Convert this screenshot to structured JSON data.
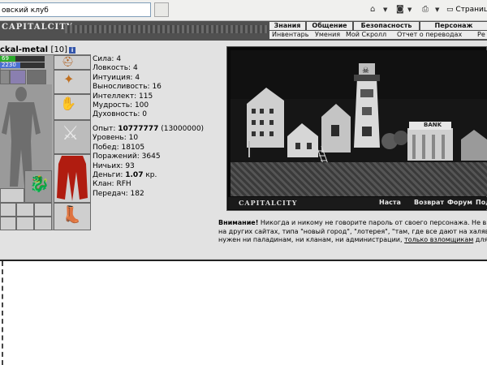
{
  "browser": {
    "tab_title": "овский клуб",
    "page_menu": "Страница"
  },
  "header": {
    "logo": "CAPITALCITY",
    "top_nav": [
      "Знания",
      "Общение",
      "Безопасность",
      "Персонаж"
    ],
    "sub_nav": [
      "Инвентарь",
      "Умения",
      "Мой Скролл",
      "Отчет о переводах",
      "Ре"
    ]
  },
  "character": {
    "name": "ckal-metal",
    "level": "[10]",
    "hp_text": "69",
    "hp_fraction": 0.35,
    "mp_text": "2230",
    "mp_fraction": 0.45,
    "attributes": [
      {
        "label": "Сила:",
        "value": "4"
      },
      {
        "label": "Ловкость:",
        "value": "4"
      },
      {
        "label": "Интуиция:",
        "value": "4"
      },
      {
        "label": "Выносливость:",
        "value": "16"
      },
      {
        "label": "Интеллект:",
        "value": "115"
      },
      {
        "label": "Мудрость:",
        "value": "100"
      },
      {
        "label": "Духовность:",
        "value": "0"
      }
    ],
    "experience_label": "Опыт:",
    "experience": "10777777",
    "experience_next": "(13000000)",
    "level_label": "Уровень:",
    "level_value": "10",
    "wins_label": "Побед:",
    "wins": "18105",
    "losses_label": "Поражений:",
    "losses": "3645",
    "draws_label": "Ничьих:",
    "draws": "93",
    "money_label": "Деньги:",
    "money": "1.07",
    "money_unit": "кр.",
    "clan_label": "Клан:",
    "clan": "RFH",
    "transfers_label": "Передач:",
    "transfers": "182"
  },
  "city": {
    "logo": "CAPITALCITY",
    "bank_sign": "BANK",
    "links": [
      "Наста",
      "Возврат",
      "Форум",
      "Под"
    ]
  },
  "warning": {
    "bold": "Внимание!",
    "line1": " Никогда и никому не говорите пароль от своего персонажа. Не в",
    "line2": "на других сайтах, типа \"новый город\", \"лотерея\", \"там, где все дают на халяв",
    "line3_pre": "нужен ни паладинам, ни кланам, ни администрации, ",
    "line3_link": "только взломщикам",
    "line3_post": " для"
  }
}
